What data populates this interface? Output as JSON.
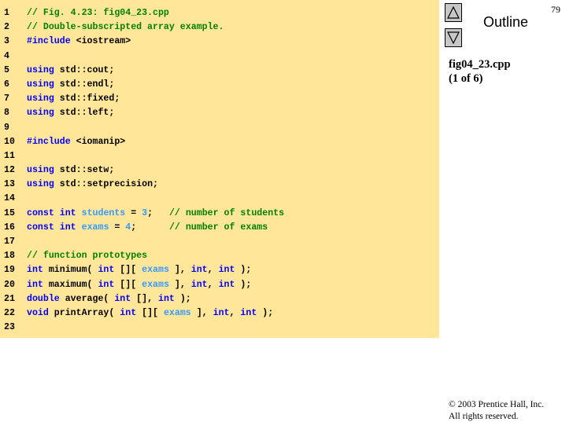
{
  "page_number": "79",
  "outline": {
    "title": "Outline",
    "up_button": "up-arrow",
    "down_button": "down-arrow"
  },
  "file_info": {
    "file_name": "fig04_23.cpp",
    "part": "(1 of 6)"
  },
  "copyright": {
    "line1": "© 2003 Prentice Hall, Inc.",
    "line2": "All rights reserved."
  },
  "code": [
    {
      "n": "1",
      "tokens": [
        {
          "t": "// Fig. 4.23: fig04_23.cpp",
          "c": "c"
        }
      ]
    },
    {
      "n": "2",
      "tokens": [
        {
          "t": "// Double-subscripted array example.",
          "c": "c"
        }
      ]
    },
    {
      "n": "3",
      "tokens": [
        {
          "t": "#include",
          "c": "k"
        },
        {
          "t": " <iostream>",
          "c": "p"
        }
      ]
    },
    {
      "n": "4",
      "tokens": []
    },
    {
      "n": "5",
      "tokens": [
        {
          "t": "using",
          "c": "k"
        },
        {
          "t": " std::cout;",
          "c": "p"
        }
      ]
    },
    {
      "n": "6",
      "tokens": [
        {
          "t": "using",
          "c": "k"
        },
        {
          "t": " std::endl;",
          "c": "p"
        }
      ]
    },
    {
      "n": "7",
      "tokens": [
        {
          "t": "using",
          "c": "k"
        },
        {
          "t": " std::fixed;",
          "c": "p"
        }
      ]
    },
    {
      "n": "8",
      "tokens": [
        {
          "t": "using",
          "c": "k"
        },
        {
          "t": " std::left;",
          "c": "p"
        }
      ]
    },
    {
      "n": "9",
      "tokens": []
    },
    {
      "n": "10",
      "tokens": [
        {
          "t": "#include",
          "c": "k"
        },
        {
          "t": " <iomanip>",
          "c": "p"
        }
      ]
    },
    {
      "n": "11",
      "tokens": []
    },
    {
      "n": "12",
      "tokens": [
        {
          "t": "using",
          "c": "k"
        },
        {
          "t": " std::setw;",
          "c": "p"
        }
      ]
    },
    {
      "n": "13",
      "tokens": [
        {
          "t": "using",
          "c": "k"
        },
        {
          "t": " std::setprecision;",
          "c": "p"
        }
      ]
    },
    {
      "n": "14",
      "tokens": []
    },
    {
      "n": "15",
      "tokens": [
        {
          "t": "const",
          "c": "k"
        },
        {
          "t": " ",
          "c": "p"
        },
        {
          "t": "int",
          "c": "k"
        },
        {
          "t": " ",
          "c": "p"
        },
        {
          "t": "students",
          "c": "v"
        },
        {
          "t": " = ",
          "c": "p"
        },
        {
          "t": "3",
          "c": "v"
        },
        {
          "t": ";   ",
          "c": "p"
        },
        {
          "t": "// number of students",
          "c": "c"
        }
      ]
    },
    {
      "n": "16",
      "tokens": [
        {
          "t": "const",
          "c": "k"
        },
        {
          "t": " ",
          "c": "p"
        },
        {
          "t": "int",
          "c": "k"
        },
        {
          "t": " ",
          "c": "p"
        },
        {
          "t": "exams",
          "c": "v"
        },
        {
          "t": " = ",
          "c": "p"
        },
        {
          "t": "4",
          "c": "v"
        },
        {
          "t": ";      ",
          "c": "p"
        },
        {
          "t": "// number of exams",
          "c": "c"
        }
      ]
    },
    {
      "n": "17",
      "tokens": []
    },
    {
      "n": "18",
      "tokens": [
        {
          "t": "// function prototypes",
          "c": "c"
        }
      ]
    },
    {
      "n": "19",
      "tokens": [
        {
          "t": "int",
          "c": "k"
        },
        {
          "t": " minimum( ",
          "c": "p"
        },
        {
          "t": "int",
          "c": "k"
        },
        {
          "t": " [][ ",
          "c": "p"
        },
        {
          "t": "exams",
          "c": "v"
        },
        {
          "t": " ], ",
          "c": "p"
        },
        {
          "t": "int",
          "c": "k"
        },
        {
          "t": ", ",
          "c": "p"
        },
        {
          "t": "int",
          "c": "k"
        },
        {
          "t": " );",
          "c": "p"
        }
      ]
    },
    {
      "n": "20",
      "tokens": [
        {
          "t": "int",
          "c": "k"
        },
        {
          "t": " maximum( ",
          "c": "p"
        },
        {
          "t": "int",
          "c": "k"
        },
        {
          "t": " [][ ",
          "c": "p"
        },
        {
          "t": "exams",
          "c": "v"
        },
        {
          "t": " ], ",
          "c": "p"
        },
        {
          "t": "int",
          "c": "k"
        },
        {
          "t": ", ",
          "c": "p"
        },
        {
          "t": "int",
          "c": "k"
        },
        {
          "t": " );",
          "c": "p"
        }
      ]
    },
    {
      "n": "21",
      "tokens": [
        {
          "t": "double",
          "c": "k"
        },
        {
          "t": " average( ",
          "c": "p"
        },
        {
          "t": "int",
          "c": "k"
        },
        {
          "t": " [], ",
          "c": "p"
        },
        {
          "t": "int",
          "c": "k"
        },
        {
          "t": " );",
          "c": "p"
        }
      ]
    },
    {
      "n": "22",
      "tokens": [
        {
          "t": "void",
          "c": "k"
        },
        {
          "t": " printArray( ",
          "c": "p"
        },
        {
          "t": "int",
          "c": "k"
        },
        {
          "t": " [][ ",
          "c": "p"
        },
        {
          "t": "exams",
          "c": "v"
        },
        {
          "t": " ], ",
          "c": "p"
        },
        {
          "t": "int",
          "c": "k"
        },
        {
          "t": ", ",
          "c": "p"
        },
        {
          "t": "int",
          "c": "k"
        },
        {
          "t": " );",
          "c": "p"
        }
      ]
    },
    {
      "n": "23",
      "tokens": []
    }
  ],
  "colors": {
    "panel_background": "#ffe699",
    "comment": "#008000",
    "keyword": "#0000ff",
    "identifier_highlight": "#3399ff",
    "plain": "#000000"
  }
}
